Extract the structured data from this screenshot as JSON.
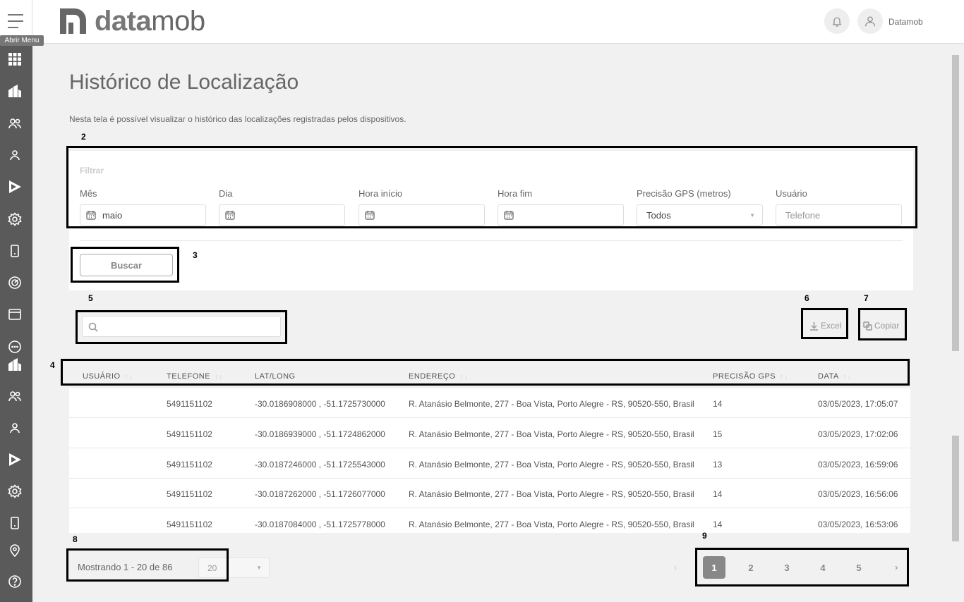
{
  "sidebar": {
    "tooltip": "Abrir Menu",
    "icons": [
      "apps-icon",
      "buildings-icon",
      "users-icon",
      "user-icon",
      "play-icon",
      "settings-icon",
      "phone-icon",
      "radar-icon",
      "browser-icon",
      "chat-icon",
      "buildings-icon",
      "users-icon",
      "user-icon",
      "play-icon",
      "settings-icon",
      "phone-icon",
      "location-icon",
      "help-icon"
    ]
  },
  "header": {
    "logo_bold": "data",
    "logo_light": "mob",
    "user_name": "Datamob"
  },
  "page": {
    "title": "Histórico de Localização",
    "description": "Nesta tela é possível visualizar o histórico das localizações registradas pelos dispositivos."
  },
  "filter": {
    "title": "Filtrar",
    "month_label": "Mês",
    "month_value": "maio",
    "day_label": "Dia",
    "start_label": "Hora início",
    "end_label": "Hora fim",
    "precision_label": "Precisão GPS (metros)",
    "precision_value": "Todos",
    "user_label": "Usuário",
    "user_placeholder": "Telefone",
    "search_button": "Buscar"
  },
  "tools": {
    "excel": "Excel",
    "copy": "Copiar"
  },
  "annotations": [
    "2",
    "3",
    "4",
    "5",
    "6",
    "7",
    "8",
    "9"
  ],
  "table": {
    "headers": [
      "USUÁRIO",
      "TELEFONE",
      "LAT/LONG",
      "ENDEREÇO",
      "PRECISÃO GPS",
      "DATA"
    ],
    "rows": [
      {
        "usuario": "",
        "telefone": "5491151102",
        "latlong": "-30.0186908000 , -51.1725730000",
        "endereco": "R. Atanásio Belmonte, 277 - Boa Vista, Porto Alegre - RS, 90520-550, Brasil",
        "precisao": "14",
        "data": "03/05/2023, 17:05:07"
      },
      {
        "usuario": "",
        "telefone": "5491151102",
        "latlong": "-30.0186939000 , -51.1724862000",
        "endereco": "R. Atanásio Belmonte, 277 - Boa Vista, Porto Alegre - RS, 90520-550, Brasil",
        "precisao": "15",
        "data": "03/05/2023, 17:02:06"
      },
      {
        "usuario": "",
        "telefone": "5491151102",
        "latlong": "-30.0187246000 , -51.1725543000",
        "endereco": "R. Atanásio Belmonte, 277 - Boa Vista, Porto Alegre - RS, 90520-550, Brasil",
        "precisao": "13",
        "data": "03/05/2023, 16:59:06"
      },
      {
        "usuario": "",
        "telefone": "5491151102",
        "latlong": "-30.0187262000 , -51.1726077000",
        "endereco": "R. Atanásio Belmonte, 277 - Boa Vista, Porto Alegre - RS, 90520-550, Brasil",
        "precisao": "14",
        "data": "03/05/2023, 16:56:06"
      },
      {
        "usuario": "",
        "telefone": "5491151102",
        "latlong": "-30.0187084000 , -51.1725778000",
        "endereco": "R. Atanásio Belmonte, 277 - Boa Vista, Porto Alegre - RS, 90520-550, Brasil",
        "precisao": "14",
        "data": "03/05/2023, 16:53:06"
      }
    ]
  },
  "pagination": {
    "showing": "Mostrando 1 - 20 de 86",
    "page_size": "20",
    "prev": "‹",
    "next": "›",
    "pages": [
      "1",
      "2",
      "3",
      "4",
      "5"
    ]
  }
}
